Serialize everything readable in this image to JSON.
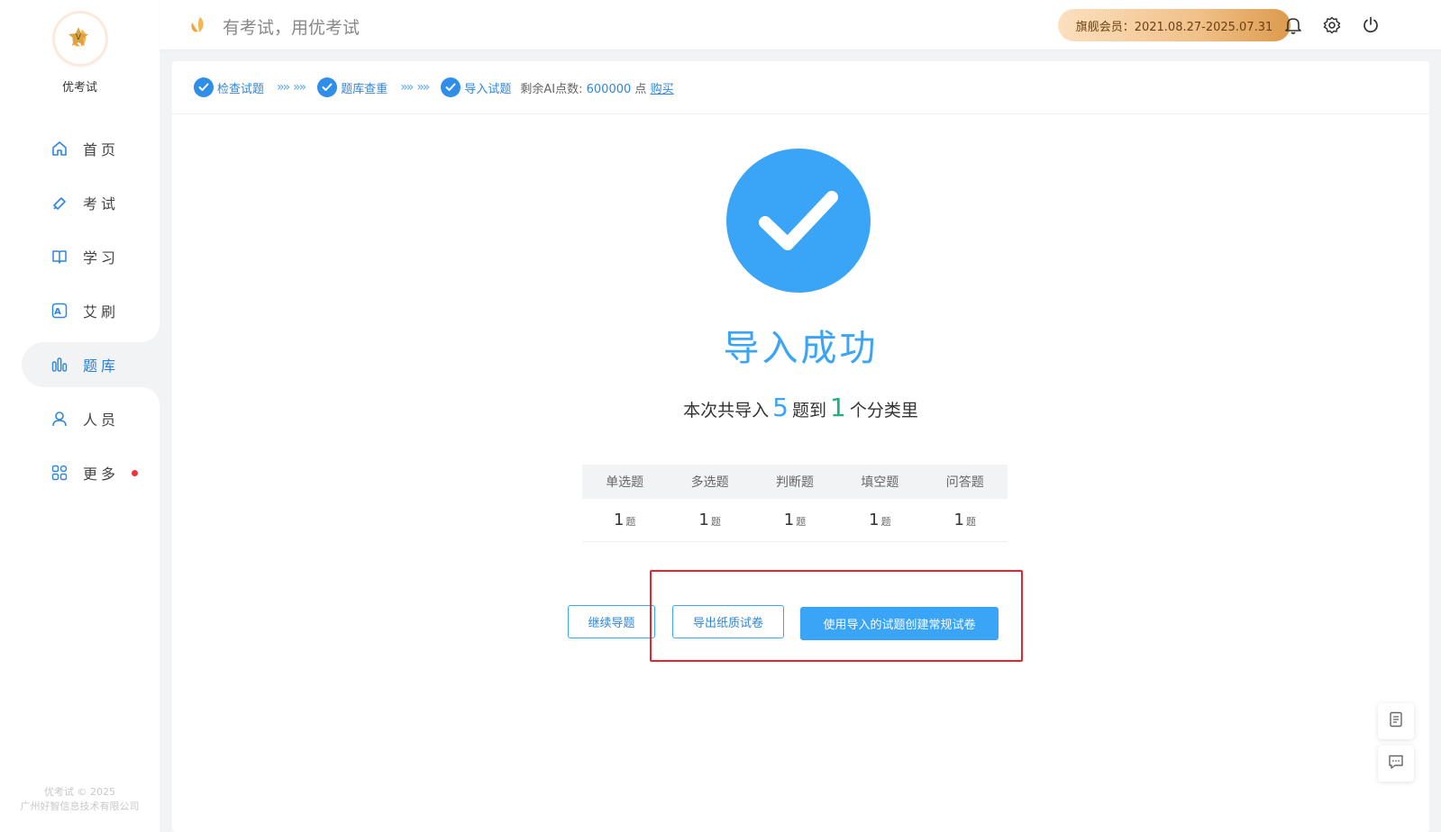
{
  "brand": {
    "name": "优考试",
    "copyright_line1": "优考试 © 2025",
    "copyright_line2": "广州好智信息技术有限公司"
  },
  "nav": [
    {
      "label": "首页",
      "icon": "home-icon",
      "active": false
    },
    {
      "label": "考试",
      "icon": "tag-icon",
      "active": false
    },
    {
      "label": "学习",
      "icon": "book-icon",
      "active": false
    },
    {
      "label": "艾刷",
      "icon": "letter-a-icon",
      "active": false
    },
    {
      "label": "题库",
      "icon": "bars-icon",
      "active": true
    },
    {
      "label": "人员",
      "icon": "user-icon",
      "active": false
    },
    {
      "label": "更多",
      "icon": "grid-icon",
      "active": false,
      "badge": "red-dot"
    }
  ],
  "header": {
    "slogan": "有考试，用优考试",
    "membership": "旗舰会员：2021.08.27-2025.07.31"
  },
  "steps": [
    {
      "label": "检查试题",
      "done": true
    },
    {
      "label": "题库查重",
      "done": true
    },
    {
      "label": "导入试题",
      "done": true
    }
  ],
  "points": {
    "prefix": "剩余AI点数:",
    "value": "600000",
    "unit": "点",
    "buy_label": "购买"
  },
  "result": {
    "title": "导入成功",
    "summary_prefix": "本次共导入",
    "question_count": "5",
    "summary_middle": "题到",
    "category_count": "1",
    "summary_suffix": "个分类里"
  },
  "question_types": {
    "headers": [
      "单选题",
      "多选题",
      "判断题",
      "填空题",
      "问答题"
    ],
    "counts": [
      "1",
      "1",
      "1",
      "1",
      "1"
    ],
    "unit": "题"
  },
  "actions": {
    "continue_label": "继续导题",
    "export_label": "导出纸质试卷",
    "create_label": "使用导入的试题创建常规试卷"
  },
  "colors": {
    "primary": "#3aa4f6",
    "success_num": "#22b07d",
    "highlight": "#e3262f"
  }
}
